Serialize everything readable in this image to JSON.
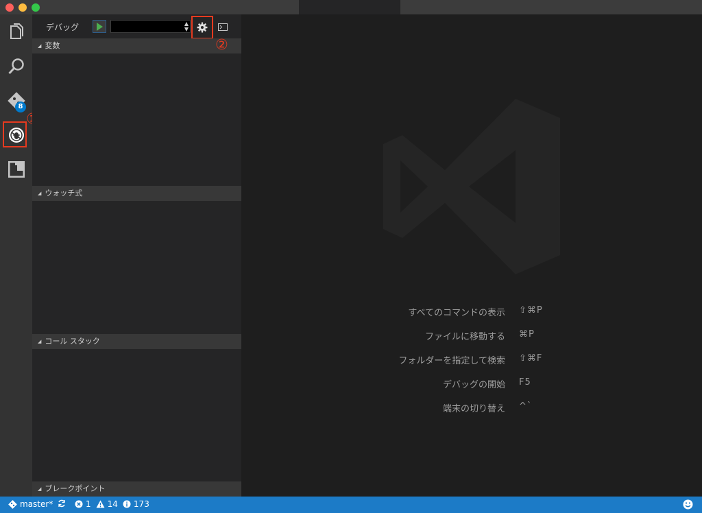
{
  "window": {
    "traffic_lights": [
      "close",
      "minimize",
      "zoom"
    ]
  },
  "activity_bar": {
    "items": [
      {
        "name": "explorer",
        "icon": "files-icon"
      },
      {
        "name": "search",
        "icon": "search-icon"
      },
      {
        "name": "git",
        "icon": "git-icon",
        "badge": "8"
      },
      {
        "name": "debug",
        "icon": "bug-icon",
        "active": true
      },
      {
        "name": "extensions",
        "icon": "extensions-icon"
      }
    ]
  },
  "debug_toolbar": {
    "title": "デバッグ",
    "config_value": "",
    "start_icon": "play-icon",
    "gear_icon": "gear-icon",
    "console_icon": "terminal-icon"
  },
  "sections": {
    "variables": "変数",
    "watch": "ウォッチ式",
    "call_stack": "コール スタック",
    "breakpoints": "ブレークポイント"
  },
  "annotations": {
    "one": "①",
    "two": "②",
    "color": "#e63a1f"
  },
  "editor": {
    "hints": [
      {
        "label": "すべてのコマンドの表示",
        "key": "⇧⌘P"
      },
      {
        "label": "ファイルに移動する",
        "key": "⌘P"
      },
      {
        "label": "フォルダーを指定して検索",
        "key": "⇧⌘F"
      },
      {
        "label": "デバッグの開始",
        "key": "F5"
      },
      {
        "label": "端末の切り替え",
        "key": "^`"
      }
    ]
  },
  "status_bar": {
    "branch": "master*",
    "errors": "1",
    "warnings": "14",
    "infos": "173",
    "color": "#1c7bc7"
  }
}
